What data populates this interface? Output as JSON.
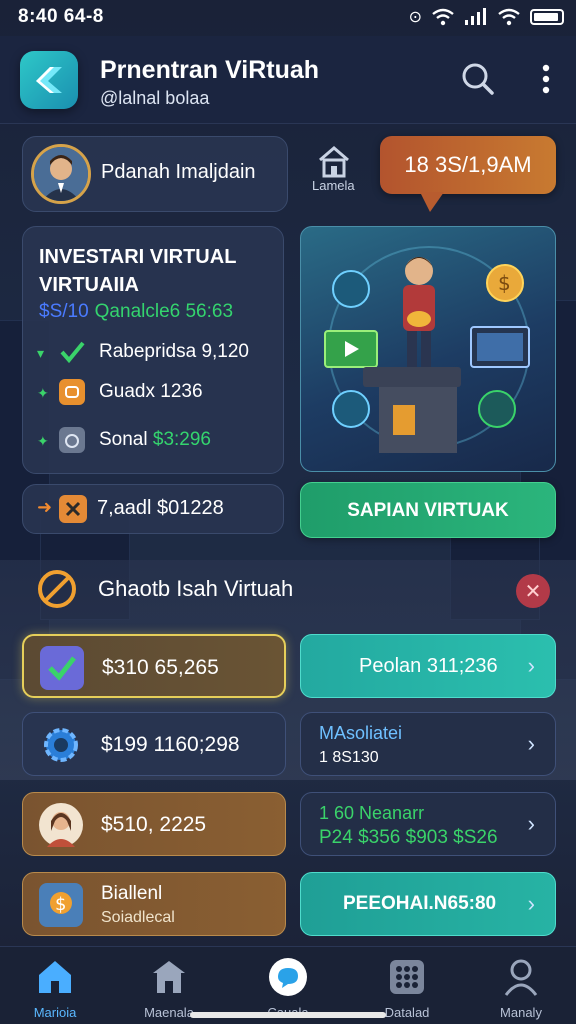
{
  "status_bar": {
    "time": "8:40 64-8"
  },
  "header": {
    "title": "Prnentran ViRtuah",
    "subtitle": "@lalnal bolaa"
  },
  "profile": {
    "name": "Pdanah Imaljdain",
    "home_label": "Lamela",
    "time_bubble": "18 3S/1,9AM"
  },
  "investment": {
    "title": "INVESTARI VIRTUAL VIRTUAIIA",
    "amount": "$S/10",
    "amount_detail": "Qanalcle6 56:63",
    "rows": [
      {
        "text": "Rabepridsa 9,120",
        "icon": "check-icon"
      },
      {
        "text": "Guadx 1236",
        "icon": "shield-icon"
      },
      {
        "text_prefix": "Sonal",
        "text_value": "$3:296",
        "icon": "camera-icon"
      }
    ],
    "promo": "7,aadl $01228"
  },
  "cta": {
    "label": "SAPIAN VIRTUAK"
  },
  "section": {
    "title": "Ghaotb Isah Virtuah"
  },
  "list": [
    {
      "left_value": "$310 65,265",
      "right_label": "Peolan 311;236"
    },
    {
      "left_value": "$199 1160;298",
      "right_line1": "MAsoliatei",
      "right_line2": "1 8S130"
    },
    {
      "left_value": "$510, 2225",
      "right_line1": "1 60 Neanarr",
      "right_line2": "P24 $356  $903 $S26"
    },
    {
      "left_line1": "Biallenl",
      "left_line2": "Soiadlecal",
      "right_label": "PEEOHAI.N65:80"
    }
  ],
  "bottom_nav": [
    {
      "label": "Marioia",
      "icon": "home-icon",
      "active": true
    },
    {
      "label": "Maenala",
      "icon": "store-icon",
      "active": false
    },
    {
      "label": "Cauala",
      "icon": "chat-icon",
      "active": false
    },
    {
      "label": "Datalad",
      "icon": "grid-icon",
      "active": false
    },
    {
      "label": "Manaly",
      "icon": "user-icon",
      "active": false
    }
  ],
  "colors": {
    "accent_green": "#34d46e",
    "accent_teal": "#2bbfae",
    "accent_orange": "#c87a30",
    "accent_blue": "#5ab8ff"
  }
}
